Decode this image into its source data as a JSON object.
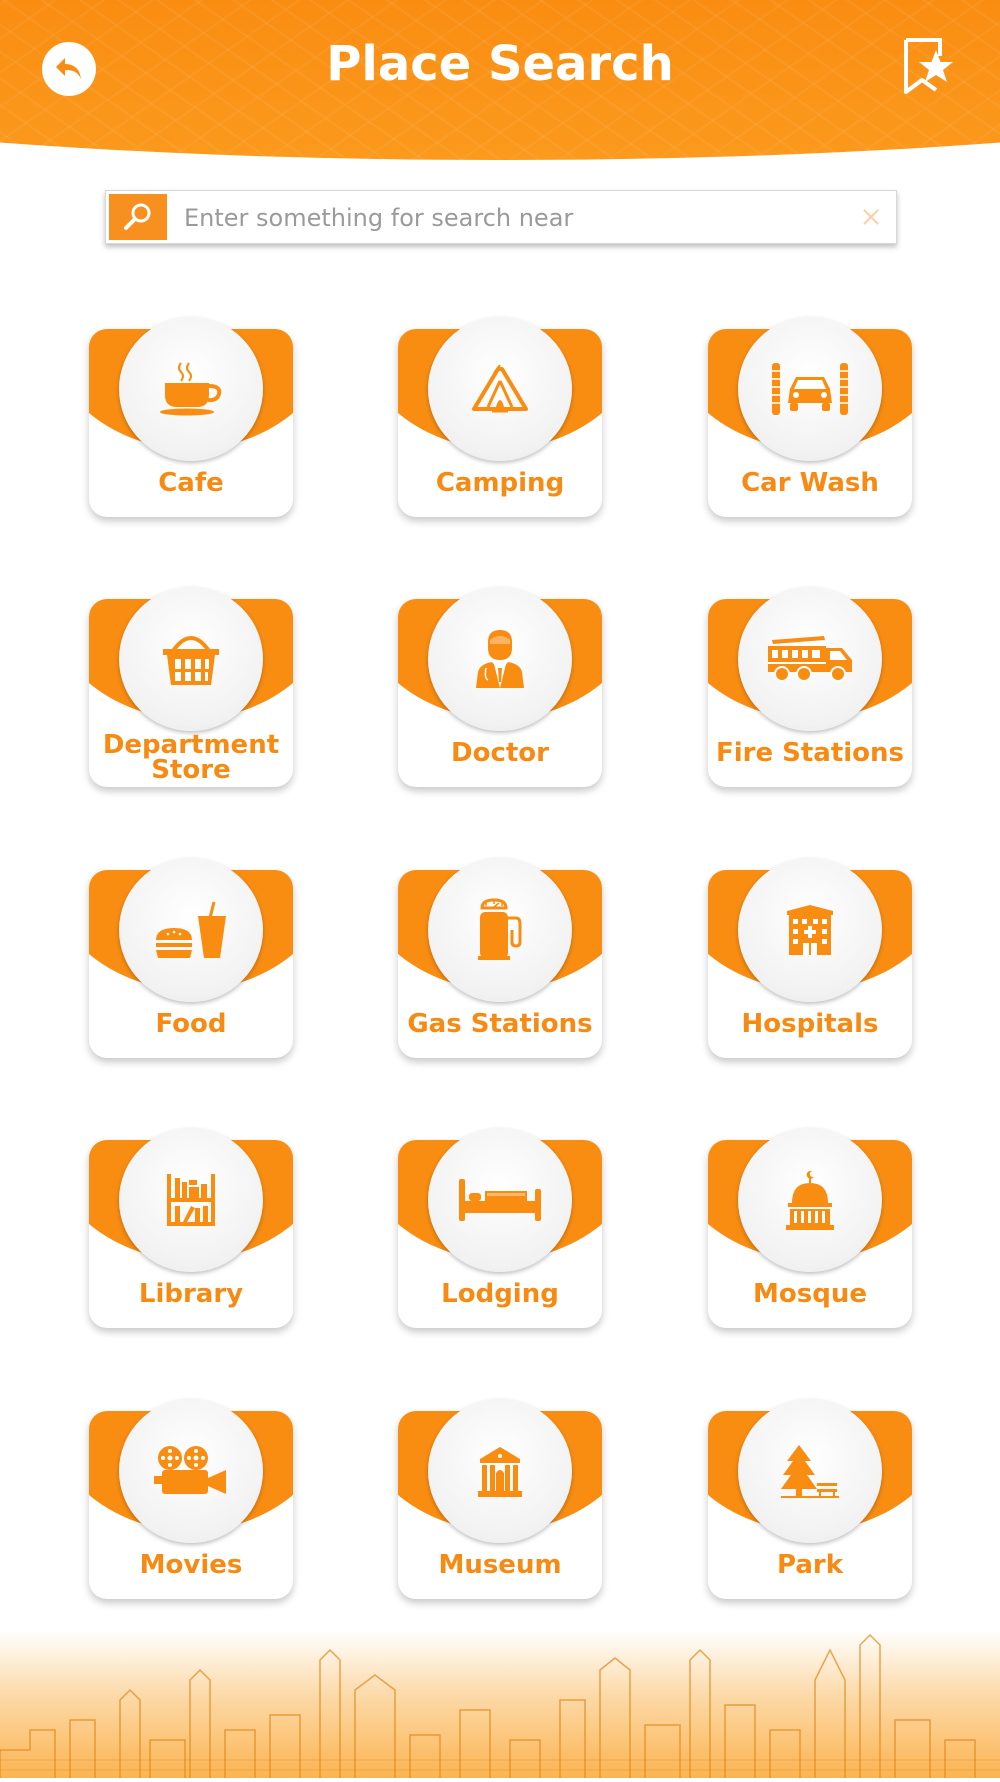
{
  "header": {
    "title": "Place Search",
    "back_icon": "back-arrow-icon",
    "bookmark_icon": "bookmark-star-icon"
  },
  "search": {
    "placeholder": "Enter something for search near",
    "value": "",
    "search_icon": "magnifier-icon",
    "clear_icon": "close-icon"
  },
  "colors": {
    "accent": "#f98d12",
    "label": "#f78a12",
    "card_bg": "#ffffff"
  },
  "categories": [
    {
      "label": "Cafe",
      "icon": "coffee-cup-icon"
    },
    {
      "label": "Camping",
      "icon": "tent-icon"
    },
    {
      "label": "Car Wash",
      "icon": "car-wash-icon"
    },
    {
      "label": "Department Store",
      "icon": "shopping-basket-icon"
    },
    {
      "label": "Doctor",
      "icon": "doctor-icon"
    },
    {
      "label": "Fire Stations",
      "icon": "fire-truck-icon"
    },
    {
      "label": "Food",
      "icon": "burger-drink-icon"
    },
    {
      "label": "Gas Stations",
      "icon": "fuel-pump-icon"
    },
    {
      "label": "Hospitals",
      "icon": "hospital-icon"
    },
    {
      "label": "Library",
      "icon": "bookshelf-icon"
    },
    {
      "label": "Lodging",
      "icon": "bed-icon"
    },
    {
      "label": "Mosque",
      "icon": "mosque-icon"
    },
    {
      "label": "Movies",
      "icon": "movie-camera-icon"
    },
    {
      "label": "Museum",
      "icon": "museum-icon"
    },
    {
      "label": "Park",
      "icon": "tree-bench-icon"
    }
  ]
}
